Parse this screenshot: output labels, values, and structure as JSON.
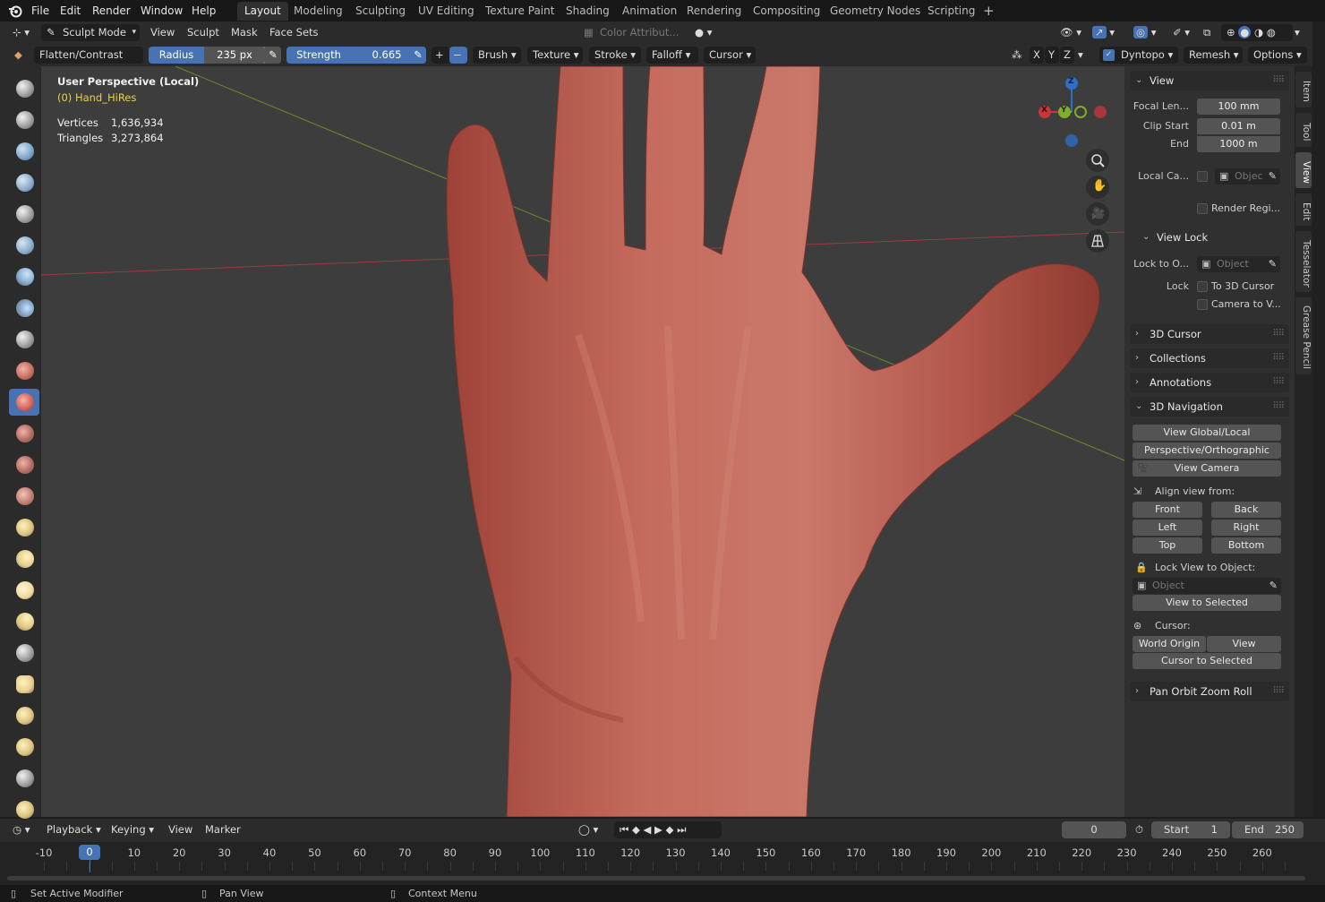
{
  "topbar": {
    "menus": [
      "File",
      "Edit",
      "Render",
      "Window",
      "Help"
    ],
    "workspaces": [
      "Layout",
      "Modeling",
      "Sculpting",
      "UV Editing",
      "Texture Paint",
      "Shading",
      "Animation",
      "Rendering",
      "Compositing",
      "Geometry Nodes",
      "Scripting"
    ],
    "active_workspace": "Layout",
    "add_icon": "plus-icon"
  },
  "header": {
    "mode": "Sculpt Mode",
    "menus": [
      "View",
      "Sculpt",
      "Mask",
      "Face Sets"
    ],
    "color_attribute": "Color Attribut...",
    "brush_name": "Flatten/Contrast",
    "radius_label": "Radius",
    "radius_value": "235 px",
    "strength_label": "Strength",
    "strength_value": "0.665",
    "dropdowns": [
      "Brush",
      "Texture",
      "Stroke",
      "Falloff",
      "Cursor"
    ],
    "symmetry": [
      "X",
      "Y",
      "Z"
    ],
    "dyntopo": "Dyntopo",
    "remesh": "Remesh",
    "options": "Options"
  },
  "viewport": {
    "perspective": "User Perspective (Local)",
    "object": "(0) Hand_HiRes",
    "vertices_label": "Vertices",
    "vertices_value": "1,636,934",
    "triangles_label": "Triangles",
    "triangles_value": "3,273,864",
    "gizmo_axes": [
      "X",
      "Y",
      "Z"
    ],
    "colors": {
      "background": "#3d3d3d",
      "mesh": "#b8564a",
      "x_axis": "#c8363d",
      "y_axis": "#82ad2a",
      "z_axis": "#2e6fc8"
    }
  },
  "npanel": {
    "tabs": [
      "Item",
      "Tool",
      "View",
      "Edit",
      "Tesselator",
      "Grease Pencil"
    ],
    "active_tab": "View",
    "view": {
      "title": "View",
      "focal_label": "Focal Len...",
      "focal_value": "100 mm",
      "clip_start_label": "Clip Start",
      "clip_start_value": "0.01 m",
      "clip_end_label": "End",
      "clip_end_value": "1000 m",
      "local_camera_label": "Local Ca...",
      "local_camera_placeholder": "Objec",
      "render_region": "Render Regi..."
    },
    "view_lock": {
      "title": "View Lock",
      "lock_to_label": "Lock to O...",
      "lock_to_placeholder": "Object",
      "lock_label": "Lock",
      "to_3d_cursor": "To 3D Cursor",
      "camera_to_view": "Camera to V..."
    },
    "collapsed_panels": [
      "3D Cursor",
      "Collections",
      "Annotations"
    ],
    "nav": {
      "title": "3D Navigation",
      "view_global_local": "View Global/Local",
      "persp_ortho": "Perspective/Orthographic",
      "view_camera": "View Camera",
      "align_label": "Align view from:",
      "front": "Front",
      "back": "Back",
      "left": "Left",
      "right": "Right",
      "top": "Top",
      "bottom": "Bottom",
      "lock_view_label": "Lock View to Object:",
      "object_placeholder": "Object",
      "view_to_selected": "View to Selected",
      "cursor_label": "Cursor:",
      "world_origin": "World Origin",
      "view": "View",
      "cursor_to_selected": "Cursor to Selected"
    },
    "pan_orbit": "Pan Orbit Zoom Roll"
  },
  "timeline": {
    "menus": [
      "Playback",
      "Keying",
      "View",
      "Marker"
    ],
    "current_frame": "0",
    "start_label": "Start",
    "start_value": "1",
    "end_label": "End",
    "end_value": "250",
    "ticks": [
      "-10",
      "0",
      "10",
      "20",
      "30",
      "40",
      "50",
      "60",
      "70",
      "80",
      "90",
      "100",
      "110",
      "120",
      "130",
      "140",
      "150",
      "160",
      "170",
      "180",
      "190",
      "200",
      "210",
      "220",
      "230",
      "240",
      "250",
      "260"
    ],
    "playhead": "0"
  },
  "statusbar": {
    "left": "Set Active Modifier",
    "middle": "Pan View",
    "right": "Context Menu"
  }
}
